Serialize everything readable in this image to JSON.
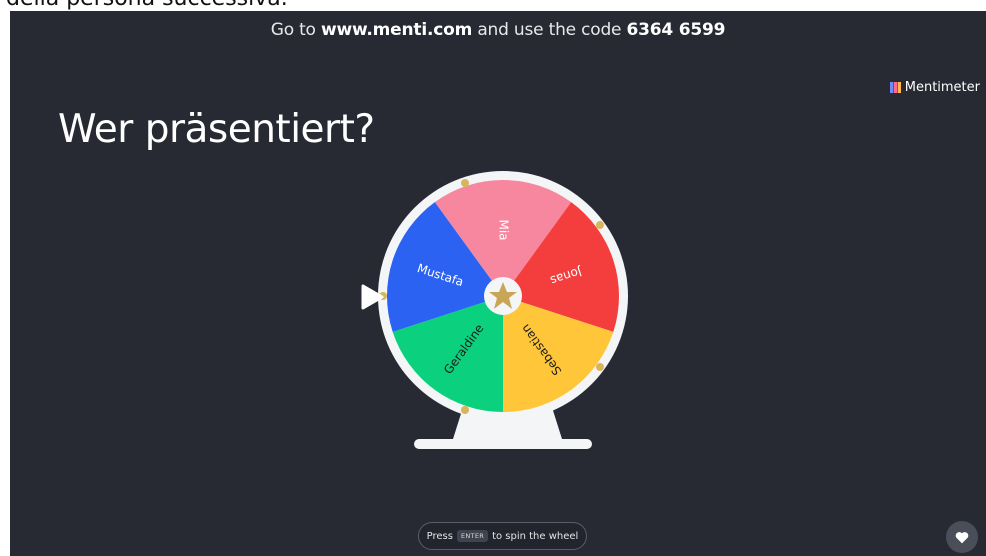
{
  "caption": "della persona successiva.",
  "join": {
    "prefix": "Go to",
    "url": "www.menti.com",
    "middle": "and use the code",
    "code": "6364 6599"
  },
  "brand": {
    "name": "Mentimeter",
    "icon": "mentimeter-logo"
  },
  "title": "Wer präsentiert?",
  "wheel": {
    "segments": [
      {
        "name": "Mia",
        "color": "#F7879F"
      },
      {
        "name": "Jonas",
        "color": "#F43E3E"
      },
      {
        "name": "Sebastian",
        "color": "#FFC63A"
      },
      {
        "name": "Geraldine",
        "color": "#0BD17E"
      },
      {
        "name": "Mustafa",
        "color": "#2B62F2"
      }
    ],
    "center_icon": "star-icon",
    "pointer_icon": "play-pointer-icon"
  },
  "hint": {
    "press": "Press",
    "key": "ENTER",
    "rest": "to spin the wheel"
  },
  "reaction": {
    "icon": "heart-icon"
  }
}
